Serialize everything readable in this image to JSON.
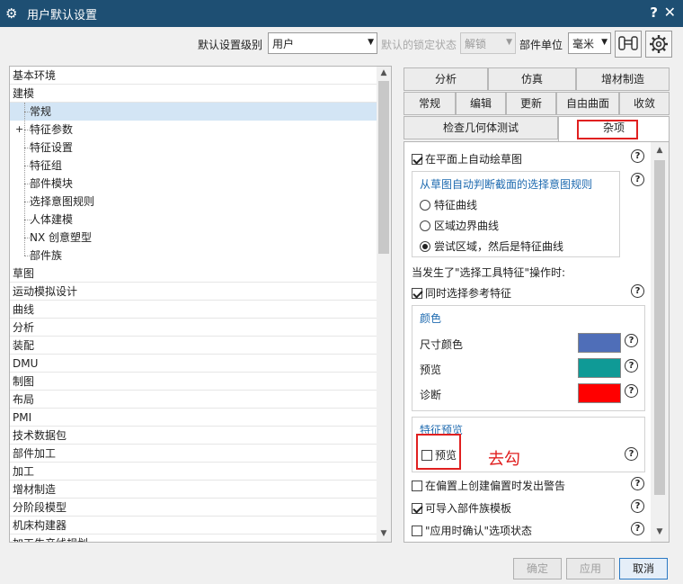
{
  "window": {
    "title": "用户默认设置",
    "help": "?",
    "close": "✕"
  },
  "toolbar": {
    "level_label": "默认设置级别",
    "level_value": "用户",
    "lock_label": "默认的锁定状态",
    "lock_value": "解锁",
    "unit_label": "部件单位",
    "unit_value": "毫米"
  },
  "tree": {
    "items": [
      {
        "label": "基本环境"
      },
      {
        "label": "建模"
      },
      {
        "label": "常规"
      },
      {
        "label": "特征参数"
      },
      {
        "label": "特征设置"
      },
      {
        "label": "特征组"
      },
      {
        "label": "部件模块"
      },
      {
        "label": "选择意图规则"
      },
      {
        "label": "人体建模"
      },
      {
        "label": "NX 创意塑型"
      },
      {
        "label": "部件族"
      },
      {
        "label": "草图"
      },
      {
        "label": "运动模拟设计"
      },
      {
        "label": "曲线"
      },
      {
        "label": "分析"
      },
      {
        "label": "装配"
      },
      {
        "label": "DMU"
      },
      {
        "label": "制图"
      },
      {
        "label": "布局"
      },
      {
        "label": "PMI"
      },
      {
        "label": "技术数据包"
      },
      {
        "label": "部件加工"
      },
      {
        "label": "加工"
      },
      {
        "label": "增材制造"
      },
      {
        "label": "分阶段模型"
      },
      {
        "label": "机床构建器"
      },
      {
        "label": "加工生产线规划"
      }
    ],
    "expander": "+"
  },
  "tabs": {
    "row1": [
      "分析",
      "仿真",
      "增材制造"
    ],
    "row2": [
      "常规",
      "编辑",
      "更新",
      "自由曲面",
      "收敛"
    ],
    "row3": [
      "检查几何体测试",
      "杂项"
    ]
  },
  "panel": {
    "auto_sketch": "在平面上自动绘草图",
    "intent_group_title": "从草图自动判断截面的选择意图规则",
    "radio_options": [
      "特征曲线",
      "区域边界曲线",
      "尝试区域，然后是特征曲线"
    ],
    "select_tool_text": "当发生了\"选择工具特征\"操作时:",
    "select_reference": "同时选择参考特征",
    "color_group_title": "颜色",
    "colors": [
      {
        "label": "尺寸颜色",
        "color": "#4f6eb8"
      },
      {
        "label": "预览",
        "color": "#0f9a96"
      },
      {
        "label": "诊断",
        "color": "#ff0000"
      }
    ],
    "preview_group_title": "特征预览",
    "preview_checkbox": "预览",
    "annotation": "去勾",
    "warn_offset": "在偏置上创建偏置时发出警告",
    "importable_template": "可导入部件族模板",
    "confirm_apply": "\"应用时确认\"选项状态",
    "help_glyph": "?"
  },
  "buttons": {
    "ok": "确定",
    "apply": "应用",
    "cancel": "取消"
  }
}
